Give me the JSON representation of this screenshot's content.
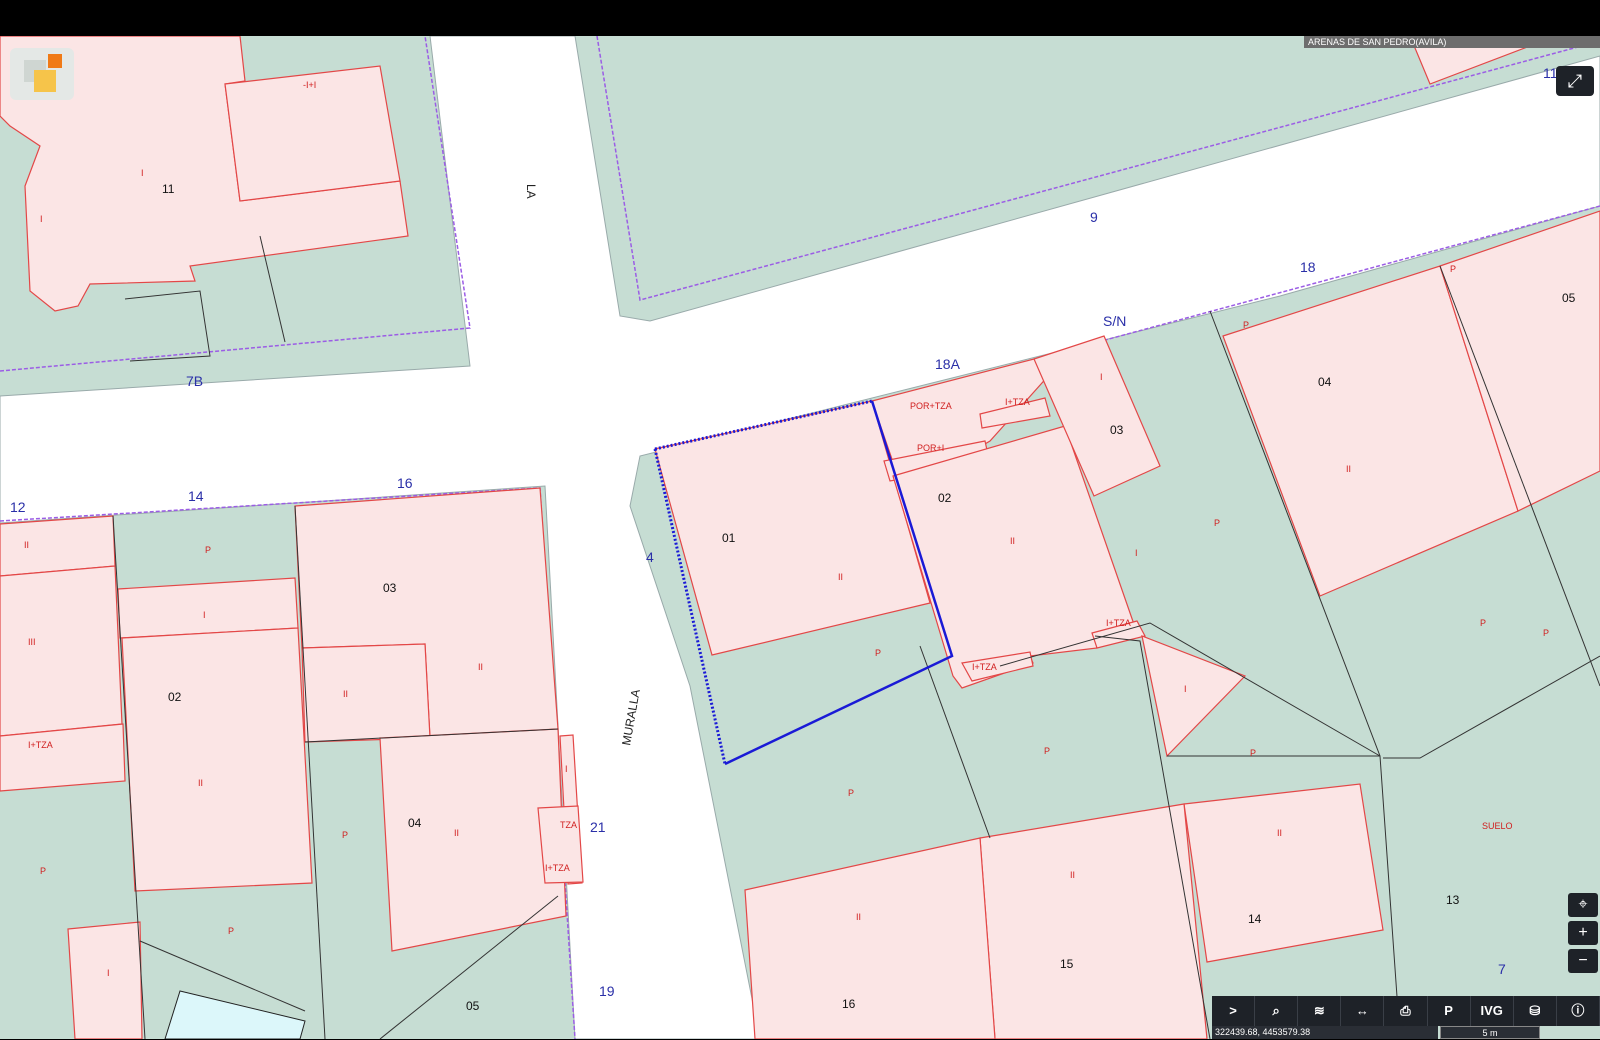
{
  "header": {
    "municipality": "ARENAS DE SAN PEDRO(AVILA)"
  },
  "colors": {
    "parcel_fill": "#c6ddd3",
    "building_fill": "#fbe5e5",
    "building_stroke": "#e34747",
    "street_fill": "#ffffff",
    "boundary": "#9b5de5",
    "selection": "#1a1ad6"
  },
  "icons": {
    "expand": "expand-icon",
    "locate": "crosshair-icon",
    "zoom_in": "plus-icon",
    "zoom_out": "minus-icon"
  },
  "parcel_labels": [
    "11",
    "03",
    "05",
    "04",
    "02",
    "01",
    "03",
    "02",
    "04",
    "16",
    "15",
    "14",
    "13",
    "05"
  ],
  "building_labels": [
    "-I+I",
    "I",
    "I",
    "II",
    "III",
    "I",
    "I+TZA",
    "II",
    "P",
    "I",
    "II",
    "II",
    "II",
    "P",
    "I",
    "TZA",
    "I+TZA",
    "P",
    "P",
    "P",
    "POR+TZA",
    "I+TZA",
    "POR+I",
    "I",
    "II",
    "II",
    "P",
    "I+TZA",
    "I+TZA",
    "I",
    "P",
    "P",
    "P",
    "II",
    "II",
    "II",
    "II",
    "SUELO",
    "P",
    "P",
    "P",
    "I",
    "P"
  ],
  "street_numbers": [
    "7B",
    "12",
    "14",
    "16",
    "9",
    "18",
    "S/N",
    "18A",
    "11",
    "4",
    "21",
    "19",
    "7"
  ],
  "street_names": [
    "MURALLA",
    "LA"
  ],
  "toolbar": {
    "items": [
      ">",
      "⌕",
      "≋",
      "↔",
      "⎙",
      "P",
      "IVG",
      "⛁",
      "ⓘ"
    ]
  },
  "status": {
    "coords": "322439.68, 4453579.38",
    "scale": "5 m"
  }
}
